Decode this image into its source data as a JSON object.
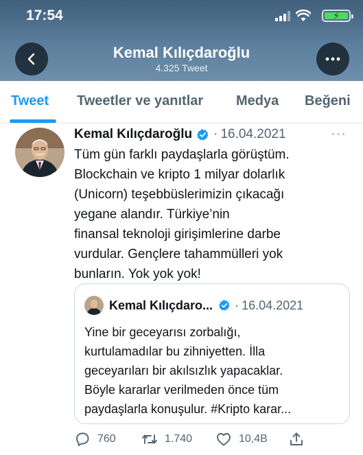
{
  "status_bar": {
    "time": "17:54"
  },
  "header": {
    "title": "Kemal Kılıçdaroğlu",
    "subtitle": "4.325 Tweet"
  },
  "icons": {
    "back": "back-arrow-icon",
    "more": "more-horizontal-icon",
    "verified": "verified-badge-icon",
    "reply": "reply-icon",
    "retweet": "retweet-icon",
    "like": "heart-icon",
    "share": "share-icon"
  },
  "colors": {
    "accent": "#1d9bf0",
    "verified": "#1d9bf0",
    "header_bg": "#4d6f8d"
  },
  "tabs": [
    {
      "label": "Tweet",
      "active": true
    },
    {
      "label": "Tweetler ve yanıtlar",
      "active": false
    },
    {
      "label": "Medya",
      "active": false
    },
    {
      "label": "Beğeni",
      "active": false
    }
  ],
  "tweet": {
    "author": "Kemal Kılıçdaroğlu",
    "separator": "·",
    "date": "16.04.2021",
    "more": "···",
    "lines": [
      "Tüm gün farklı paydaşlarla görüştüm.",
      "Blockchain ve kripto 1 milyar dolarlık",
      "(Unicorn) teşebbüslerimizin çıkacağı",
      "yegane alandır. Türkiye’nin",
      "finansal teknoloji girişimlerine darbe",
      "vurdular. Gençlere tahammülleri yok",
      "bunların. Yok yok yok!"
    ],
    "quote": {
      "author": "Kemal Kılıçdaro...",
      "separator": "·",
      "date": "16.04.2021",
      "lines": [
        "Yine bir geceyarısı zorbalığı,",
        "kurtulamadılar bu zihniyetten. İlla",
        "geceyarıları bir akılsızlık yapacaklar.",
        "Böyle kararlar verilmeden önce tüm",
        "paydaşlarla konuşulur. #Kripto karar..."
      ]
    },
    "actions": {
      "replies": "760",
      "retweets": "1.740",
      "likes": "10,4B"
    }
  }
}
